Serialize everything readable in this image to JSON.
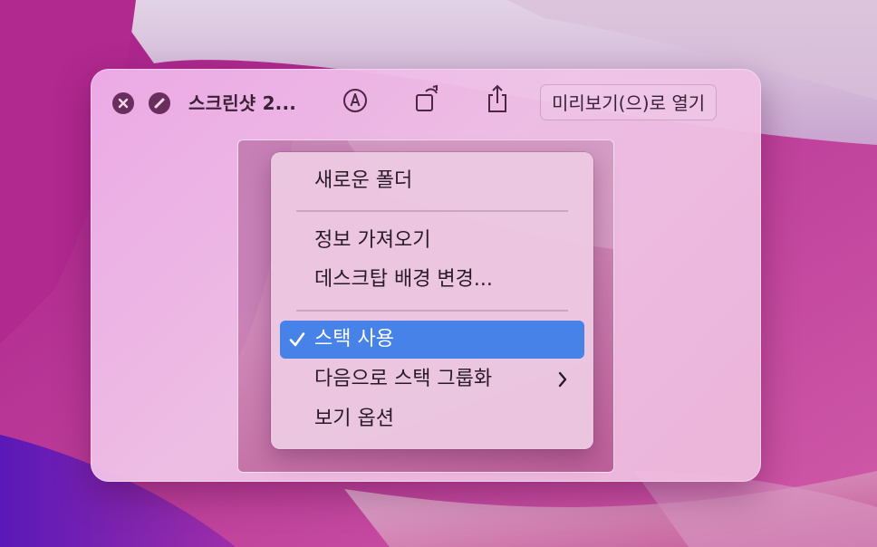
{
  "quicklook": {
    "title": "스크린샷 2...",
    "open_button_label": "미리보기(으)로 열기"
  },
  "icons": {
    "close": "close-icon",
    "fullscreen": "fullscreen-icon",
    "markup": "markup-icon",
    "rotate": "rotate-icon",
    "share": "share-icon",
    "checkmark": "checkmark-icon",
    "submenu": "chevron-right-icon"
  },
  "context_menu": {
    "items": [
      {
        "label": "새로운 폴더"
      },
      {
        "label": "정보 가져오기"
      },
      {
        "label": "데스크탑 배경 변경..."
      },
      {
        "label": "스택 사용",
        "checked": true
      },
      {
        "label": "다음으로 스택 그룹화",
        "has_submenu": true
      },
      {
        "label": "보기 옵션"
      }
    ]
  },
  "colors": {
    "selection": "#4682e8",
    "toolbar_button": "#6a2e5e"
  }
}
